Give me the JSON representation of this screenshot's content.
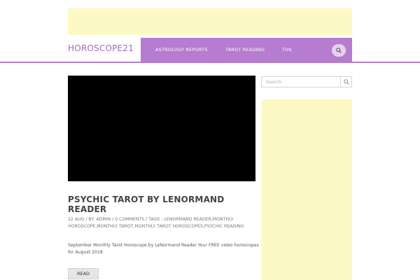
{
  "header": {
    "logo": "HOROSCOPE21"
  },
  "nav": {
    "items": [
      {
        "label": "ASTROLOGY REPORTS"
      },
      {
        "label": "TAROT READING"
      },
      {
        "label": "TOS"
      }
    ],
    "search_icon": "search-icon"
  },
  "post": {
    "title": "PSYCHIC TAROT BY LENORMAND READER",
    "meta": "22 AUG / BY: ADMIN / 0 COMMENTS / TAGS : LENORMAND READER,MONTHLY HOROSCOPE,MONTHLY TAROT,MONTHLY TAROT HOROSCOPES,PSYCHIC READING",
    "excerpt": "September Monthly Tarot Horoscope by LeNormand Reader Your FREE video horoscopes for August 2018",
    "read_label": "READ"
  },
  "sidebar": {
    "search_placeholder": "Search"
  },
  "colors": {
    "accent": "#b67ccf",
    "logo": "#a36bc2",
    "ad_background": "#fdf9c4"
  }
}
